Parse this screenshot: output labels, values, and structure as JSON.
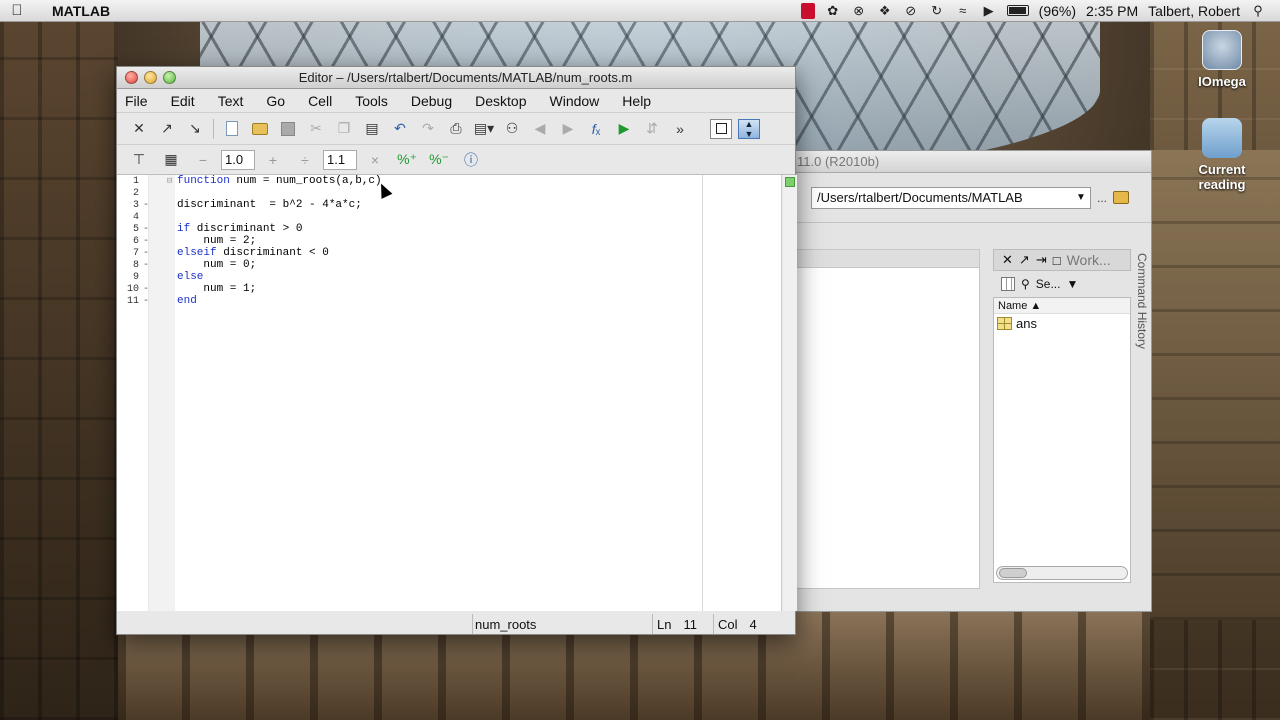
{
  "menubar": {
    "app_name": "MATLAB",
    "battery": "(96%)",
    "time": "2:35 PM",
    "user": "Talbert, Robert"
  },
  "desktop_icons": [
    {
      "label": "IOmega",
      "icon": "drive-icon"
    },
    {
      "label": "Current reading",
      "icon": "folder-icon"
    }
  ],
  "bg_window": {
    "title_fragment": "11.0 (R2010b)",
    "path": "/Users/rtalbert/Documents/MATLAB",
    "ellipsis": "...",
    "workspace_title": "Work...",
    "select_label": "Se...",
    "name_column": "Name",
    "variables": [
      {
        "name": "ans"
      }
    ],
    "command_history_tab": "Command History"
  },
  "editor": {
    "title": "Editor – /Users/rtalbert/Documents/MATLAB/num_roots.m",
    "menu": [
      "File",
      "Edit",
      "Text",
      "Go",
      "Cell",
      "Tools",
      "Debug",
      "Desktop",
      "Window",
      "Help"
    ],
    "cell_step_1": "1.0",
    "cell_step_2": "1.1",
    "code_lines": [
      {
        "n": "1",
        "dash": "",
        "text": "function num = num_roots(a,b,c)",
        "kw": "function"
      },
      {
        "n": "2",
        "dash": "",
        "text": "",
        "kw": ""
      },
      {
        "n": "3",
        "dash": "-",
        "text": "discriminant  = b^2 - 4*a*c;",
        "kw": ""
      },
      {
        "n": "4",
        "dash": "",
        "text": "",
        "kw": ""
      },
      {
        "n": "5",
        "dash": "-",
        "text": "if discriminant > 0",
        "kw": "if"
      },
      {
        "n": "6",
        "dash": "-",
        "text": "    num = 2;",
        "kw": ""
      },
      {
        "n": "7",
        "dash": "-",
        "text": "elseif discriminant < 0",
        "kw": "elseif"
      },
      {
        "n": "8",
        "dash": "-",
        "text": "    num = 0;",
        "kw": ""
      },
      {
        "n": "9",
        "dash": "",
        "text": "else",
        "kw": "else"
      },
      {
        "n": "10",
        "dash": "-",
        "text": "    num = 1;",
        "kw": ""
      },
      {
        "n": "11",
        "dash": "-",
        "text": "end",
        "kw": "end"
      }
    ],
    "status": {
      "function": "num_roots",
      "ln_label": "Ln",
      "ln": "11",
      "col_label": "Col",
      "col": "4"
    }
  },
  "colors": {
    "keyword": "#1a33cc",
    "ok_mark": "#7cd06c"
  }
}
